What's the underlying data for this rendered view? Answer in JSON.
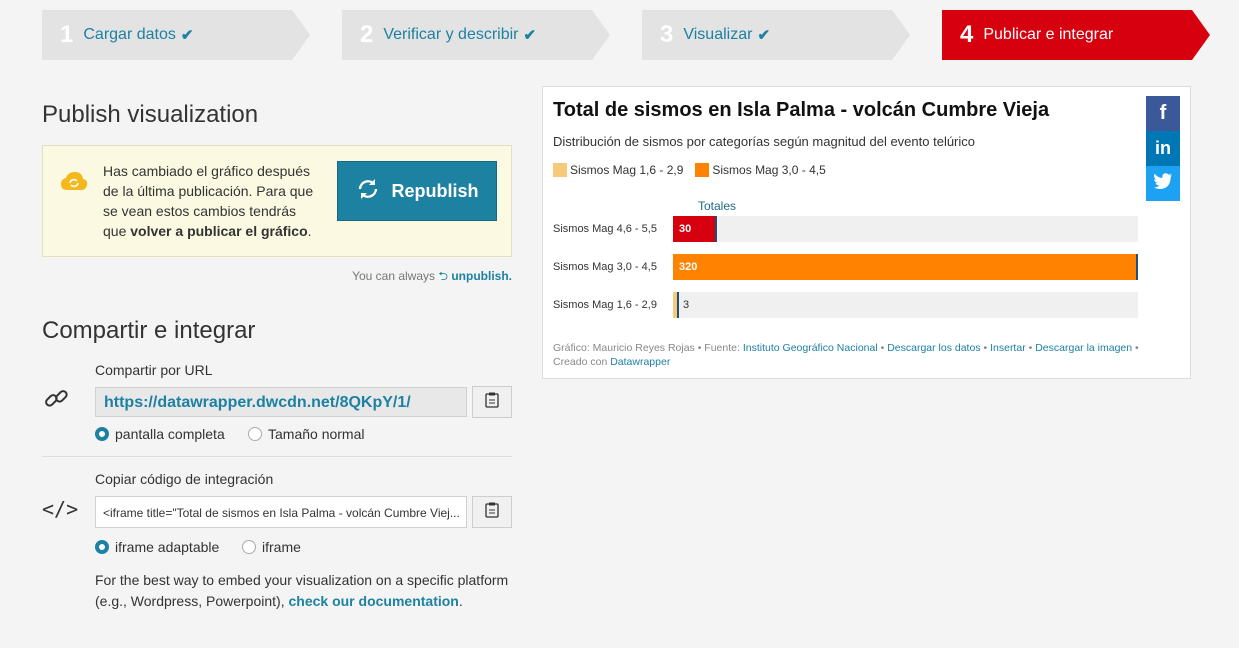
{
  "steps": [
    {
      "num": "1",
      "label": "Cargar datos",
      "check": "✔"
    },
    {
      "num": "2",
      "label": "Verificar y describir",
      "check": "✔"
    },
    {
      "num": "3",
      "label": "Visualizar",
      "check": "✔"
    },
    {
      "num": "4",
      "label": "Publicar e integrar",
      "check": ""
    }
  ],
  "publish": {
    "title": "Publish visualization",
    "notice_part1": "Has cambiado el gráfico después de la última publicación. Para que se vean estos cambios tendrás que ",
    "notice_bold": "volver a publicar el gráfico",
    "notice_part2": ".",
    "republish_label": "Republish",
    "unpublish_prefix": "You can always",
    "unpublish_link": "unpublish."
  },
  "share": {
    "title": "Compartir e integrar",
    "url_label": "Compartir por URL",
    "url_value": "https://datawrapper.dwcdn.net/8QKpY/1/",
    "url_opt1": "pantalla completa",
    "url_opt2": "Tamaño normal",
    "embed_label": "Copiar código de integración",
    "embed_value": "<iframe title=\"Total de sismos en Isla Palma - volcán Cumbre Viej...",
    "embed_opt1": "iframe adaptable",
    "embed_opt2": "iframe",
    "note_text": "For the best way to embed your visualization on a specific platform (e.g., Wordpress, Powerpoint), ",
    "note_link": "check our documentation",
    "note_end": "."
  },
  "colors": {
    "accent": "#1d81a2",
    "active_step": "#d7000f",
    "bar_red": "#d7000f",
    "bar_orange": "#ff8200",
    "bar_yellow": "#f7c97a"
  },
  "social": {
    "facebook": "f",
    "linkedin": "in",
    "twitter": "twitter-icon"
  },
  "chart_data": {
    "type": "bar",
    "title": "Total de sismos en Isla Palma - volcán Cumbre Vieja",
    "subtitle": "Distribución de sismos por categorías según magnitud del evento telúrico",
    "legend": [
      "Sismos Mag 1,6 - 2,9",
      "Sismos Mag 3,0 - 4,5"
    ],
    "column_header": "Totales",
    "categories": [
      "Sismos Mag 4,6 - 5,5",
      "Sismos Mag 3,0 - 4,5",
      "Sismos Mag 1,6 - 2,9"
    ],
    "values": [
      30,
      320,
      3
    ],
    "value_labels": [
      "30",
      "320",
      "3"
    ],
    "xlim": [
      0,
      320
    ],
    "footer": {
      "grafico_prefix": "Gráfico: Mauricio Reyes Rojas • Fuente: ",
      "fuente": "Instituto Geográfico Nacional",
      "descargar_datos": "Descargar los datos",
      "insertar": "Insertar",
      "descargar_imagen": "Descargar la imagen",
      "creado_prefix": "Creado con ",
      "creado_con": "Datawrapper"
    }
  }
}
